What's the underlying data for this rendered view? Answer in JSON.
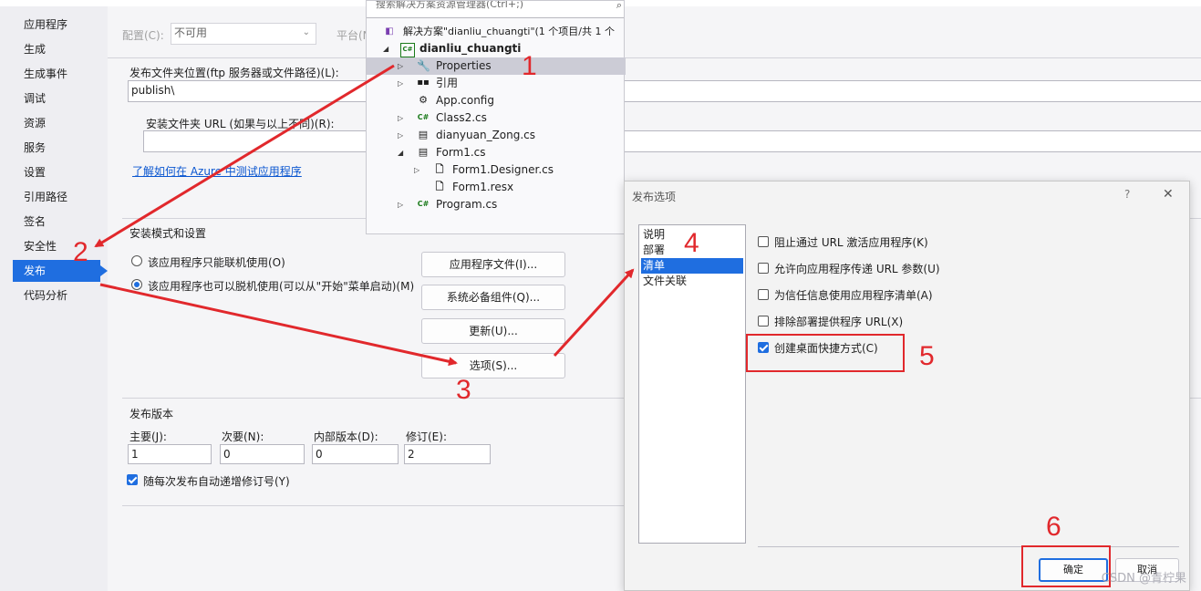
{
  "top_strip": {},
  "left_nav": {
    "items": [
      {
        "label": "应用程序"
      },
      {
        "label": "生成"
      },
      {
        "label": "生成事件"
      },
      {
        "label": "调试"
      },
      {
        "label": "资源"
      },
      {
        "label": "服务"
      },
      {
        "label": "设置"
      },
      {
        "label": "引用路径"
      },
      {
        "label": "签名"
      },
      {
        "label": "安全性"
      },
      {
        "label": "发布"
      },
      {
        "label": "代码分析"
      }
    ],
    "active": "发布"
  },
  "config_bar": {
    "config_label": "配置(C):",
    "config_value": "不可用",
    "platform_label": "平台(N"
  },
  "publish": {
    "folder_label": "发布文件夹位置(ftp 服务器或文件路径)(L):",
    "folder_value": "publish\\",
    "install_url_label": "安装文件夹 URL (如果与以上不同)(R):",
    "install_url_value": "",
    "azure_link": "了解如何在 Azure 中测试应用程序",
    "install_mode_title": "安装模式和设置",
    "radio_online": "该应用程序只能联机使用(O)",
    "radio_offline": "该应用程序也可以脱机使用(可以从\"开始\"菜单启动)(M)",
    "btn_app_files": "应用程序文件(I)...",
    "btn_prereq": "系统必备组件(Q)...",
    "btn_updates": "更新(U)...",
    "btn_options": "选项(S)..."
  },
  "version": {
    "title": "发布版本",
    "major_label": "主要(J):",
    "minor_label": "次要(N):",
    "build_label": "内部版本(D):",
    "revision_label": "修订(E):",
    "major": "1",
    "minor": "0",
    "build": "0",
    "revision": "2",
    "auto_increment": "随每次发布自动递增修订号(Y)"
  },
  "solution_explorer": {
    "search": "搜索解决方案资源管理器(Ctrl+;)",
    "solution": "解决方案\"dianliu_chuangti\"(1 个项目/共 1 个",
    "project": "dianliu_chuangti",
    "items": [
      {
        "label": "Properties",
        "icon": "wrench-icon"
      },
      {
        "label": "引用",
        "icon": "references-icon"
      },
      {
        "label": "App.config",
        "icon": "config-file-icon"
      },
      {
        "label": "Class2.cs",
        "icon": "csharp-icon"
      },
      {
        "label": "dianyuan_Zong.cs",
        "icon": "form-icon"
      },
      {
        "label": "Form1.cs",
        "icon": "form-icon"
      },
      {
        "label": "Form1.Designer.cs",
        "icon": "code-file-icon"
      },
      {
        "label": "Form1.resx",
        "icon": "resource-file-icon"
      },
      {
        "label": "Program.cs",
        "icon": "csharp-icon"
      }
    ]
  },
  "dialog": {
    "title": "发布选项",
    "help": "?",
    "close": "✕",
    "list": [
      "说明",
      "部署",
      "清单",
      "文件关联"
    ],
    "selected": "清单",
    "options": [
      {
        "label": "阻止通过 URL 激活应用程序(K)",
        "checked": false
      },
      {
        "label": "允许向应用程序传递 URL 参数(U)",
        "checked": false
      },
      {
        "label": "为信任信息使用应用程序清单(A)",
        "checked": false
      },
      {
        "label": "排除部署提供程序 URL(X)",
        "checked": false
      },
      {
        "label": "创建桌面快捷方式(C)",
        "checked": true
      }
    ],
    "ok": "确定",
    "cancel": "取消"
  },
  "annotations": {
    "n1": "1",
    "n2": "2",
    "n3": "3",
    "n4": "4",
    "n5": "5",
    "n6": "6",
    "color": "#e1282c"
  },
  "watermark": "CSDN @青柠果",
  "accent": "#1f6ee0"
}
